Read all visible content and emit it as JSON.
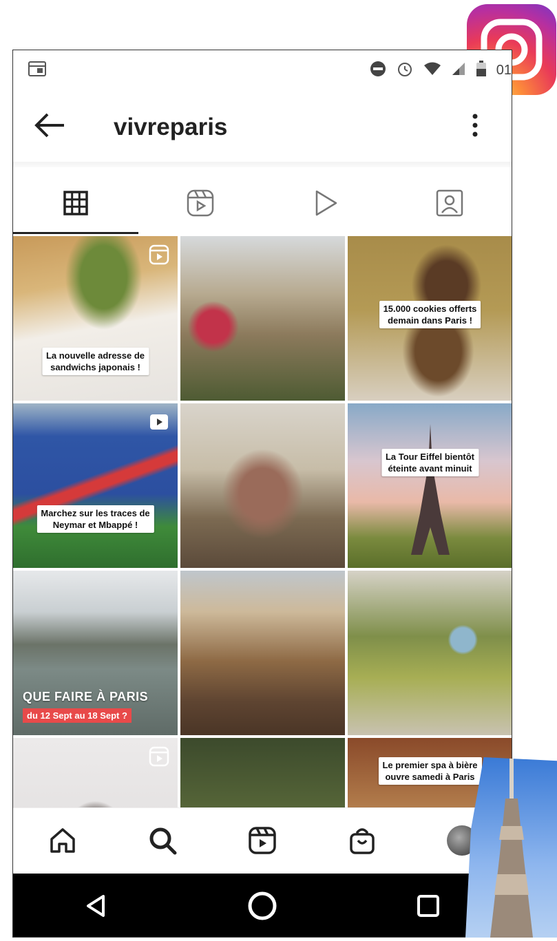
{
  "status_bar": {
    "time": "01"
  },
  "header": {
    "username": "vivreparis"
  },
  "tabs": [
    {
      "name": "posts-grid"
    },
    {
      "name": "reels"
    },
    {
      "name": "videos"
    },
    {
      "name": "tagged"
    }
  ],
  "posts": {
    "p1": {
      "caption_line1": "La nouvelle adresse de",
      "caption_line2": "sandwichs japonais !"
    },
    "p3": {
      "caption_line1": "15.000 cookies offerts",
      "caption_line2": "demain dans Paris !"
    },
    "p4": {
      "caption_line1": "Marchez sur les traces de",
      "caption_line2": "Neymar et Mbappé !"
    },
    "p6": {
      "caption_line1": "La Tour Eiffel bientôt",
      "caption_line2": "éteinte avant minuit"
    },
    "p7": {
      "title": "QUE FAIRE À PARIS",
      "dates": "du 12 Sept au 18 Sept ?"
    },
    "p12": {
      "caption_line1": "Le premier spa à bière",
      "caption_line2": "ouvre samedi à Paris"
    }
  },
  "colors": {
    "accent_red": "#e84a4a",
    "text": "#222222",
    "nav_bar": "#000000"
  }
}
